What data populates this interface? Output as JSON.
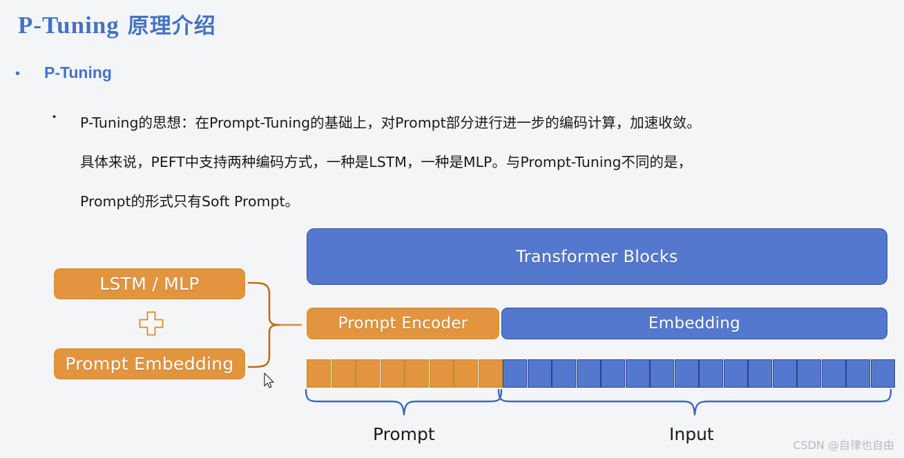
{
  "slide": {
    "title_en": "P-Tuning",
    "title_cn": "原理介绍",
    "bullet_level1": "P-Tuning",
    "bullet_level2_lines": [
      "P-Tuning的思想：在Prompt-Tuning的基础上，对Prompt部分进行进一步的编码计算，加速收敛。",
      "具体来说，PEFT中支持两种编码方式，一种是LSTM，一种是MLP。与Prompt-Tuning不同的是，",
      "Prompt的形式只有Soft Prompt。"
    ]
  },
  "diagram": {
    "left_boxes": {
      "top": "LSTM / MLP",
      "operator": "plus-sign",
      "bottom": "Prompt Embedding"
    },
    "right_boxes": {
      "transformer": "Transformer Blocks",
      "prompt_encoder": "Prompt Encoder",
      "embedding": "Embedding"
    },
    "tokens": {
      "orange_count": 8,
      "blue_count": 16
    },
    "span_labels": {
      "prompt": "Prompt",
      "input": "Input"
    }
  },
  "colors": {
    "accent_blue": "#4472c4",
    "box_blue": "#5478cd",
    "box_orange": "#e2943e",
    "background": "#f4f5f7",
    "watermark_gray": "#b9bbc0"
  },
  "watermark": "CSDN @自律也自由"
}
